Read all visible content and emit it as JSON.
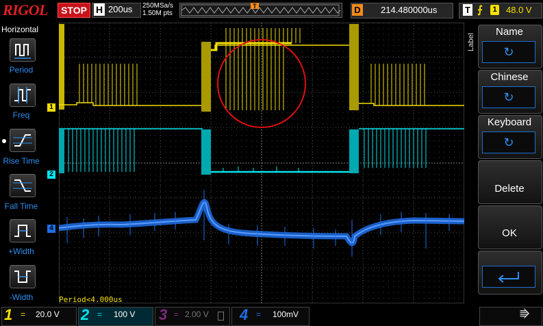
{
  "header": {
    "logo": "RIGOL",
    "run_state": "STOP",
    "timebase_label": "H",
    "timebase_value": "200us",
    "sample_rate": "250MSa/s",
    "memory_depth": "1.50M pts",
    "delay_label": "D",
    "delay_value": "214.480000us",
    "trigger_label": "T",
    "trigger_edge": "rising-edge-icon",
    "trigger_source": "1",
    "trigger_level": "48.0 V"
  },
  "left_menu": {
    "title": "Horizontal",
    "items": [
      {
        "label": "Period",
        "icon": "period-icon"
      },
      {
        "label": "Freq",
        "icon": "frequency-icon"
      },
      {
        "label": "Rise Time",
        "icon": "rise-time-icon"
      },
      {
        "label": "Fall Time",
        "icon": "fall-time-icon"
      },
      {
        "label": "+Width",
        "icon": "positive-width-icon"
      },
      {
        "label": "-Width",
        "icon": "negative-width-icon"
      }
    ]
  },
  "right_menu": {
    "side_label": "Label",
    "items": [
      {
        "title": "Name",
        "control": "circular-arrow-icon"
      },
      {
        "title": "Chinese",
        "control": "circular-arrow-icon"
      },
      {
        "title": "Keyboard",
        "control": "circular-arrow-icon"
      },
      {
        "title": "Delete"
      },
      {
        "title": "OK"
      },
      {
        "control": "enter-arrow-icon"
      }
    ]
  },
  "measurement_readout": "Period<4.000us",
  "channels": [
    {
      "number": "1",
      "coupling": "=",
      "scale": "20.0 V",
      "color": "#f4e000"
    },
    {
      "number": "2",
      "coupling": "=",
      "scale": "100 V",
      "color": "#00e5f0"
    },
    {
      "number": "3",
      "coupling": "=",
      "scale": "2.00 V",
      "color": "#b030b0"
    },
    {
      "number": "4",
      "coupling": "=",
      "scale": "100mV",
      "color": "#1e6fe8"
    }
  ],
  "channel_markers": {
    "ch1": "1",
    "ch2": "2",
    "ch4": "4"
  },
  "colors": {
    "ch1": "#f4e000",
    "ch2": "#00e5f0",
    "ch3": "#b030b0",
    "ch4": "#1e6fe8",
    "highlight_circle": "#e01010",
    "stop": "#c8131b",
    "delay": "#f28b1b"
  }
}
